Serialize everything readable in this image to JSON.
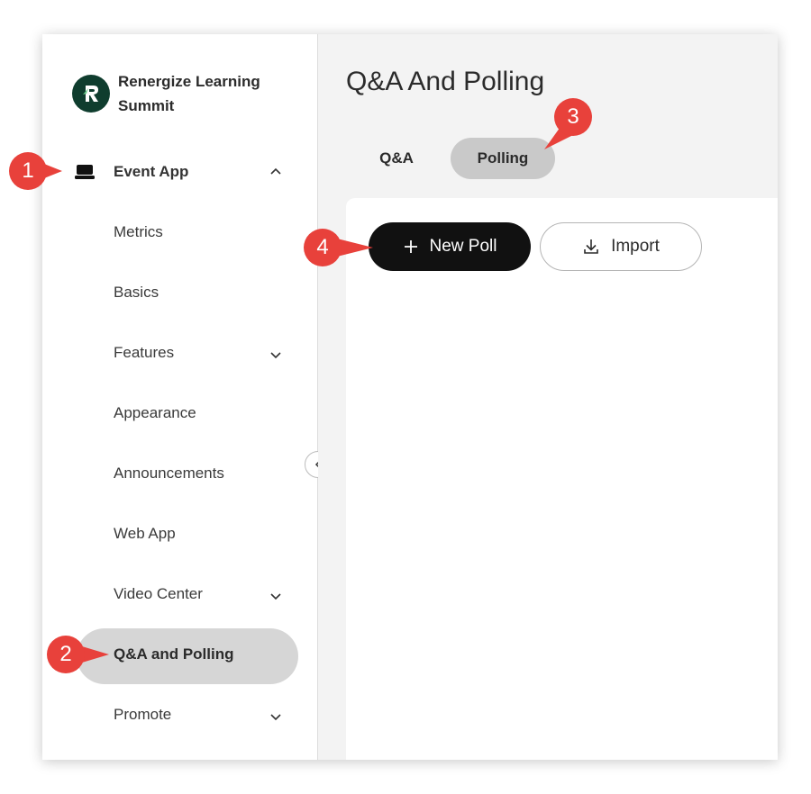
{
  "org": {
    "name": "Renergize Learning Summit"
  },
  "sidebar": {
    "section": {
      "label": "Event App",
      "icon": "laptop-icon",
      "expanded": true
    },
    "items": [
      {
        "label": "Metrics",
        "has_children": false
      },
      {
        "label": "Basics",
        "has_children": false
      },
      {
        "label": "Features",
        "has_children": true
      },
      {
        "label": "Appearance",
        "has_children": false
      },
      {
        "label": "Announcements",
        "has_children": false
      },
      {
        "label": "Web App",
        "has_children": false
      },
      {
        "label": "Video Center",
        "has_children": true
      },
      {
        "label": "Q&A and Polling",
        "has_children": false,
        "active": true
      },
      {
        "label": "Promote",
        "has_children": true
      }
    ]
  },
  "main": {
    "title": "Q&A And Polling",
    "tabs": [
      {
        "label": "Q&A",
        "active": false
      },
      {
        "label": "Polling",
        "active": true
      }
    ],
    "actions": {
      "new_poll_label": "New Poll",
      "import_label": "Import"
    }
  },
  "callouts": [
    "1",
    "2",
    "3",
    "4"
  ],
  "colors": {
    "accent_dark": "#111111",
    "active_pill": "#d6d6d6",
    "tab_active": "#c9c9c9",
    "callout_red": "#e8413b",
    "logo_bg": "#0f3d2e"
  }
}
